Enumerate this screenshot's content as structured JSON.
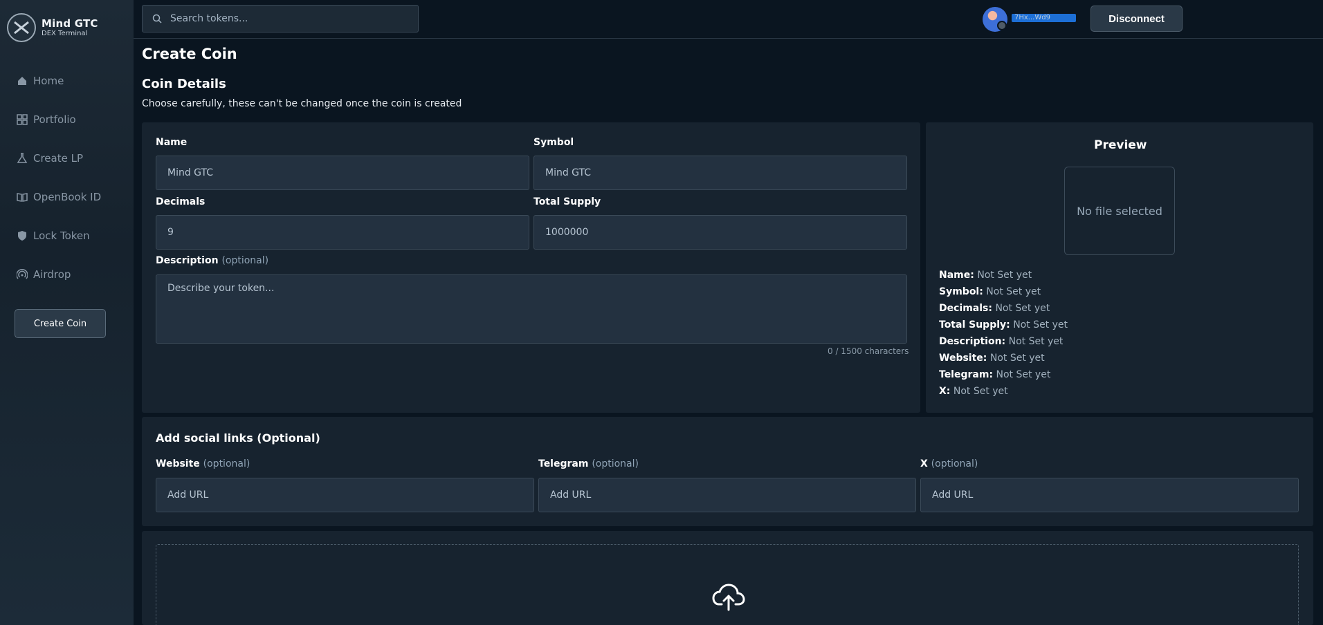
{
  "app": {
    "title": "Mind GTC",
    "subtitle": "DEX Terminal"
  },
  "sidebar": {
    "items": [
      {
        "label": "Home",
        "icon": "home-icon"
      },
      {
        "label": "Portfolio",
        "icon": "grid-icon"
      },
      {
        "label": "Create LP",
        "icon": "flask-icon"
      },
      {
        "label": "OpenBook ID",
        "icon": "book-icon"
      },
      {
        "label": "Lock Token",
        "icon": "shield-icon"
      },
      {
        "label": "Airdrop",
        "icon": "signal-icon"
      }
    ],
    "create_button": "Create Coin"
  },
  "header": {
    "search_placeholder": "Search tokens...",
    "wallet_address": "7Hx...Wd9",
    "disconnect_label": "Disconnect"
  },
  "main": {
    "page_title": "Create Coin",
    "section_title": "Coin Details",
    "section_subtitle": "Choose carefully, these can't be changed once the coin is created",
    "form": {
      "name_label": "Name",
      "name_value": "Mind GTC",
      "symbol_label": "Symbol",
      "symbol_value": "Mind GTC",
      "decimals_label": "Decimals",
      "decimals_value": "9",
      "supply_label": "Total Supply",
      "supply_value": "1000000",
      "description_label": "Description",
      "optional_text": "(optional)",
      "description_placeholder": "Describe your token...",
      "char_count": "0 / 1500 characters"
    },
    "preview": {
      "title": "Preview",
      "image_placeholder": "No file selected",
      "rows": [
        {
          "key": "Name:",
          "value": "Not Set yet"
        },
        {
          "key": "Symbol:",
          "value": "Not Set yet"
        },
        {
          "key": "Decimals:",
          "value": "Not Set yet"
        },
        {
          "key": "Total Supply:",
          "value": "Not Set yet"
        },
        {
          "key": "Description:",
          "value": "Not Set yet"
        },
        {
          "key": "Website:",
          "value": "Not Set yet"
        },
        {
          "key": "Telegram:",
          "value": "Not Set yet"
        },
        {
          "key": "X:",
          "value": "Not Set yet"
        }
      ]
    },
    "social": {
      "title": "Add social links (Optional)",
      "website_label": "Website",
      "telegram_label": "Telegram",
      "x_label": "X",
      "optional_text": "(optional)",
      "url_placeholder": "Add URL"
    }
  },
  "colors": {
    "background": "#0a1520",
    "panel": "#17232f",
    "input": "#233140",
    "accent": "#1d6fd6"
  }
}
